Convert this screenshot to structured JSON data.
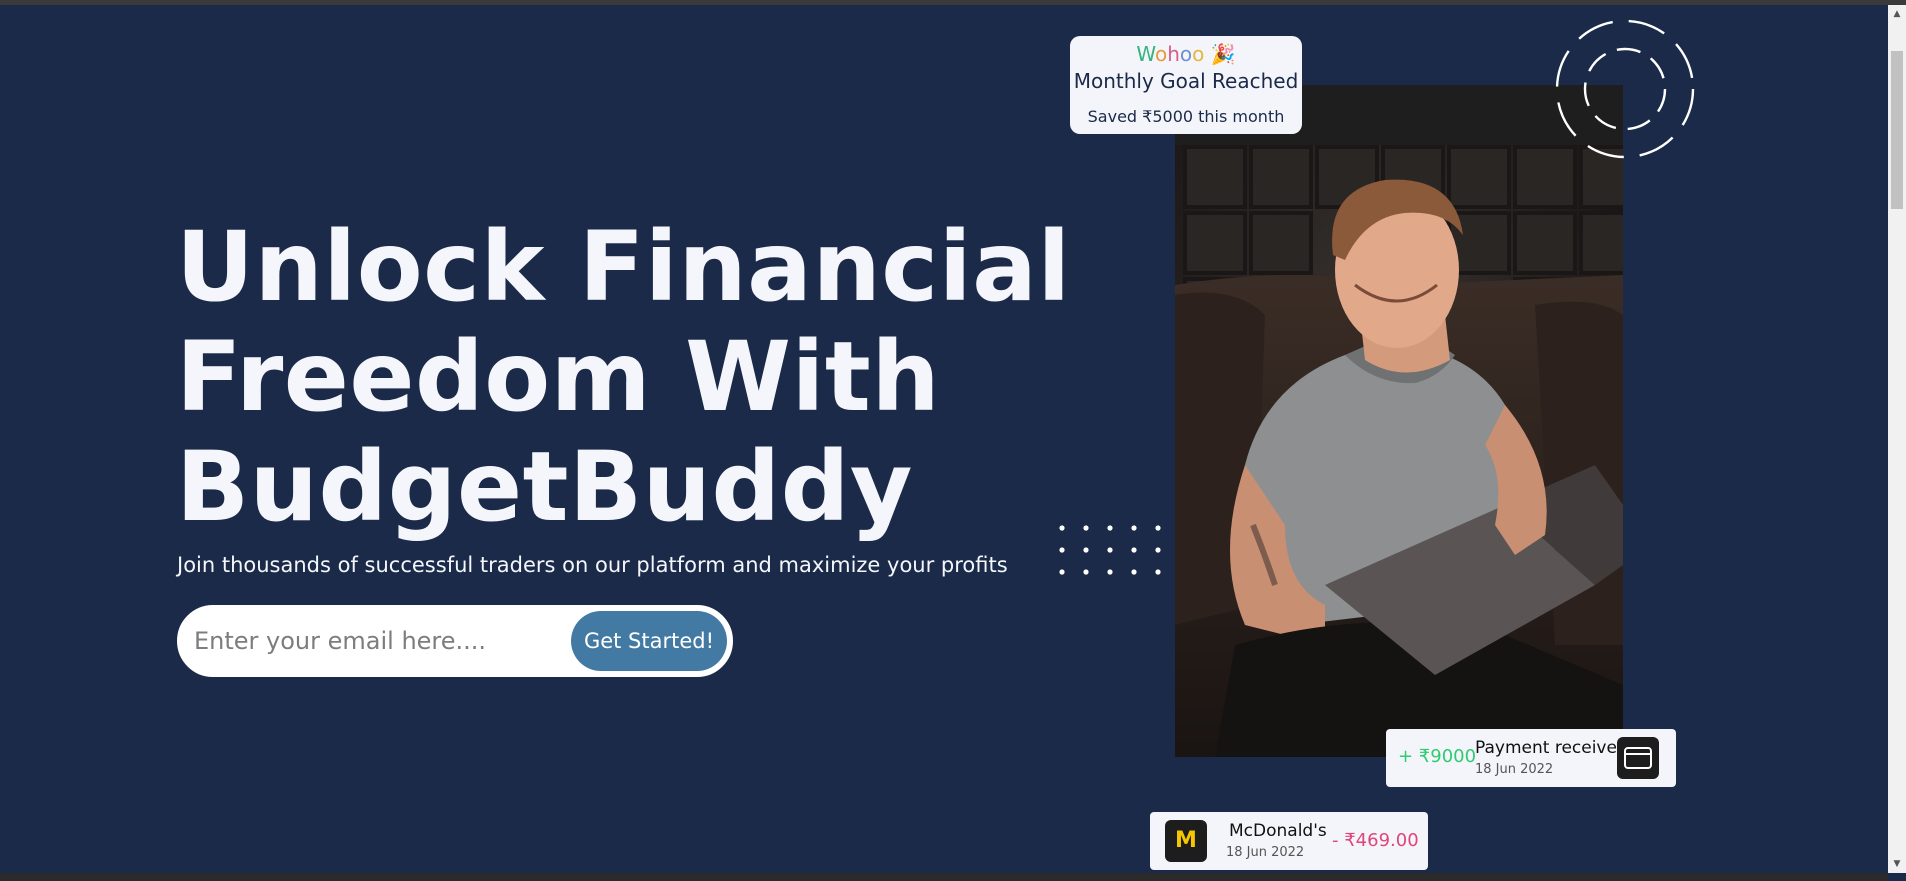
{
  "hero": {
    "title_lines": [
      "Unlock Financial",
      "Freedom With",
      "BudgetBuddy"
    ],
    "subtitle": "Join thousands of successful traders on our platform and maximize your profits"
  },
  "signup": {
    "email_placeholder": "Enter your email here....",
    "button_label": "Get Started!"
  },
  "goal_card": {
    "wohoo_letters": [
      "W",
      "o",
      "h",
      "o",
      "o"
    ],
    "emoji": "🎉",
    "title": "Monthly Goal Reached",
    "subtitle": "Saved ₹5000 this month"
  },
  "payment_card": {
    "amount": "+ ₹9000",
    "title": "Payment received",
    "date": "18 Jun 2022",
    "icon": "card-icon"
  },
  "transaction_card": {
    "logo_text": "M",
    "merchant": "McDonald's",
    "date": "18 Jun 2022",
    "amount": "- ₹469.00",
    "icon": "mcdonalds-logo"
  },
  "colors": {
    "background": "#1a2a48",
    "accent": "#437aa3",
    "positive": "#2ecc71",
    "negative": "#e0457b",
    "card": "#f4f5fb"
  }
}
